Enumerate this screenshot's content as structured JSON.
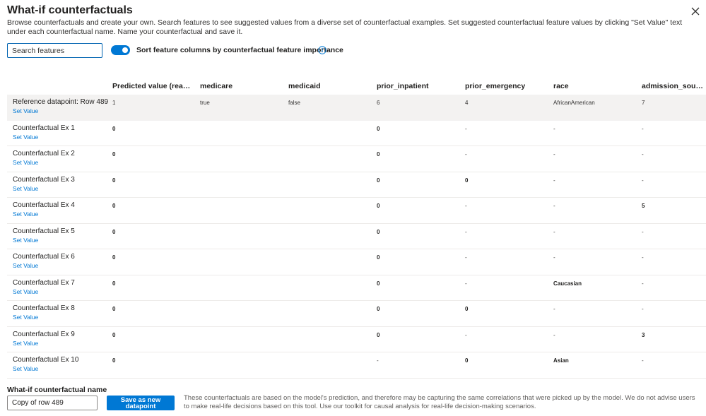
{
  "header": {
    "title": "What-if counterfactuals",
    "description": "Browse counterfactuals and create your own. Search features to see suggested values from a diverse set of counterfactual examples. Set suggested counterfactual feature values by clicking \"Set Value\" text under each counterfactual name. Name your counterfactual and save it."
  },
  "controls": {
    "search_placeholder": "Search features",
    "sort_toggle_label": "Sort feature columns by counterfactual feature importance",
    "sort_toggle_on": true
  },
  "table": {
    "columns": [
      "Predicted value (readmit_...",
      "medicare",
      "medicaid",
      "prior_inpatient",
      "prior_emergency",
      "race",
      "admission_source"
    ],
    "set_value_label": "Set Value",
    "reference": {
      "label": "Reference datapoint: Row 489",
      "values": [
        "1",
        "true",
        "false",
        "6",
        "4",
        "AfricanAmerican",
        "7"
      ]
    },
    "rows": [
      {
        "label": "Counterfactual Ex 1",
        "values": [
          "0",
          "",
          "",
          "0",
          "-",
          "-",
          "-"
        ]
      },
      {
        "label": "Counterfactual Ex 2",
        "values": [
          "0",
          "",
          "",
          "0",
          "-",
          "-",
          "-"
        ]
      },
      {
        "label": "Counterfactual Ex 3",
        "values": [
          "0",
          "",
          "",
          "0",
          "0",
          "-",
          "-"
        ]
      },
      {
        "label": "Counterfactual Ex 4",
        "values": [
          "0",
          "",
          "",
          "0",
          "-",
          "-",
          "5"
        ]
      },
      {
        "label": "Counterfactual Ex 5",
        "values": [
          "0",
          "",
          "",
          "0",
          "-",
          "-",
          "-"
        ]
      },
      {
        "label": "Counterfactual Ex 6",
        "values": [
          "0",
          "",
          "",
          "0",
          "-",
          "-",
          "-"
        ]
      },
      {
        "label": "Counterfactual Ex 7",
        "values": [
          "0",
          "",
          "",
          "0",
          "-",
          "Caucasian",
          "-"
        ]
      },
      {
        "label": "Counterfactual Ex 8",
        "values": [
          "0",
          "",
          "",
          "0",
          "0",
          "-",
          "-"
        ]
      },
      {
        "label": "Counterfactual Ex 9",
        "values": [
          "0",
          "",
          "",
          "0",
          "-",
          "-",
          "3"
        ]
      },
      {
        "label": "Counterfactual Ex 10",
        "values": [
          "0",
          "",
          "",
          "-",
          "0",
          "Asian",
          "-"
        ]
      }
    ]
  },
  "footer": {
    "name_label": "What-if counterfactual name",
    "name_value": "Copy of row 489",
    "save_label_line1": "Save as new",
    "save_label_line2": "datapoint",
    "note": "These counterfactuals are based on the model's prediction, and therefore may be capturing the same correlations that were picked up by the model. We do not advise users to make real-life decisions based on this tool. Use our toolkit for causal analysis for real-life decision-making scenarios."
  },
  "colors": {
    "accent": "#0078d4",
    "reference_row_bg": "#f3f2f1"
  }
}
